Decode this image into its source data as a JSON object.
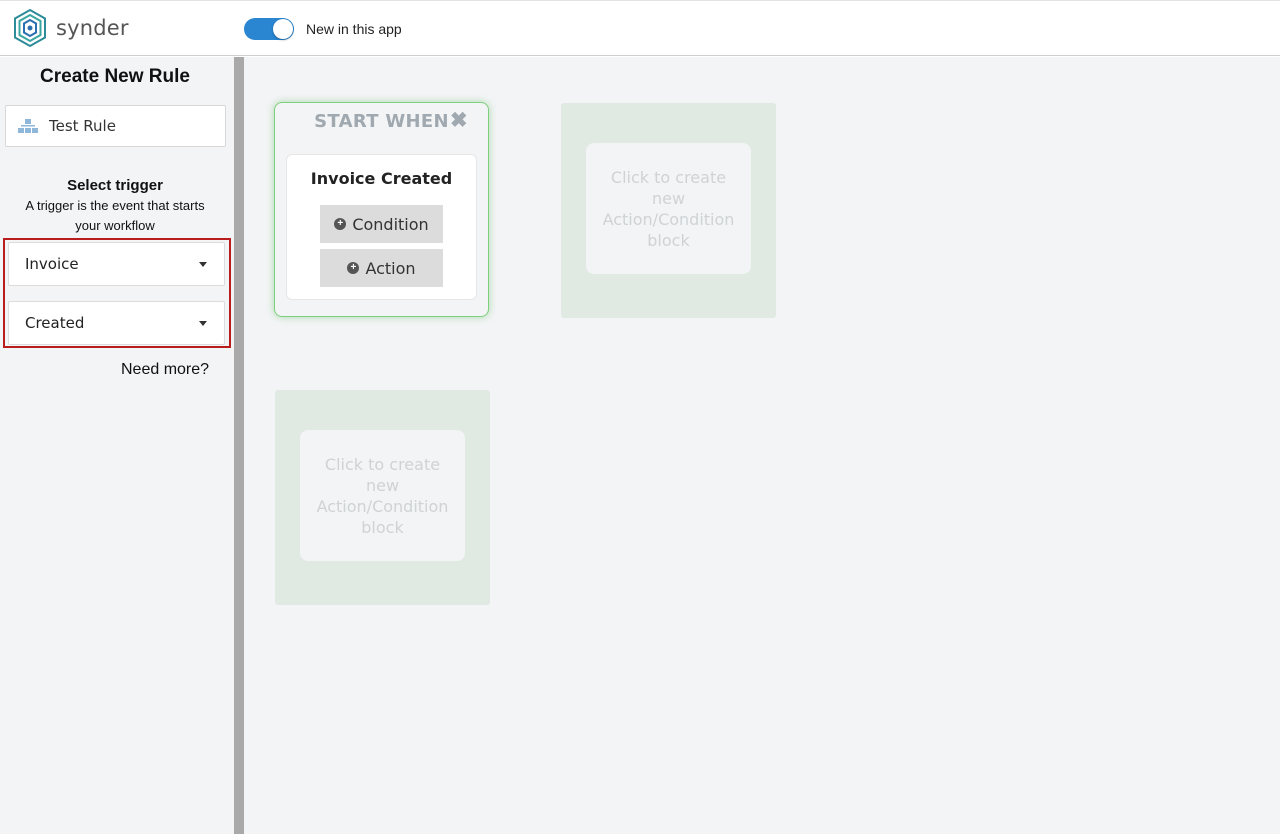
{
  "topbar": {
    "logo_text": "synder",
    "toggle_label": "New in this app",
    "toggle_on": true
  },
  "sidebar": {
    "title": "Create New Rule",
    "rule_name": "Test Rule",
    "trigger_title": "Select trigger",
    "trigger_description": "A trigger is the event that starts your workflow",
    "entity_select": "Invoice",
    "event_select": "Created",
    "need_more": "Need more?"
  },
  "canvas": {
    "start_block": {
      "header": "START WHEN",
      "trigger_name": "Invoice Created",
      "condition_button": "Condition",
      "action_button": "Action"
    },
    "placeholder_text": "Click to create new Action/Condition block"
  },
  "colors": {
    "accent_blue": "#2a86d1",
    "highlight_red": "#b81c1c",
    "start_border_green": "#7ed07e",
    "ghost_block_bg": "#e1e9e3"
  }
}
